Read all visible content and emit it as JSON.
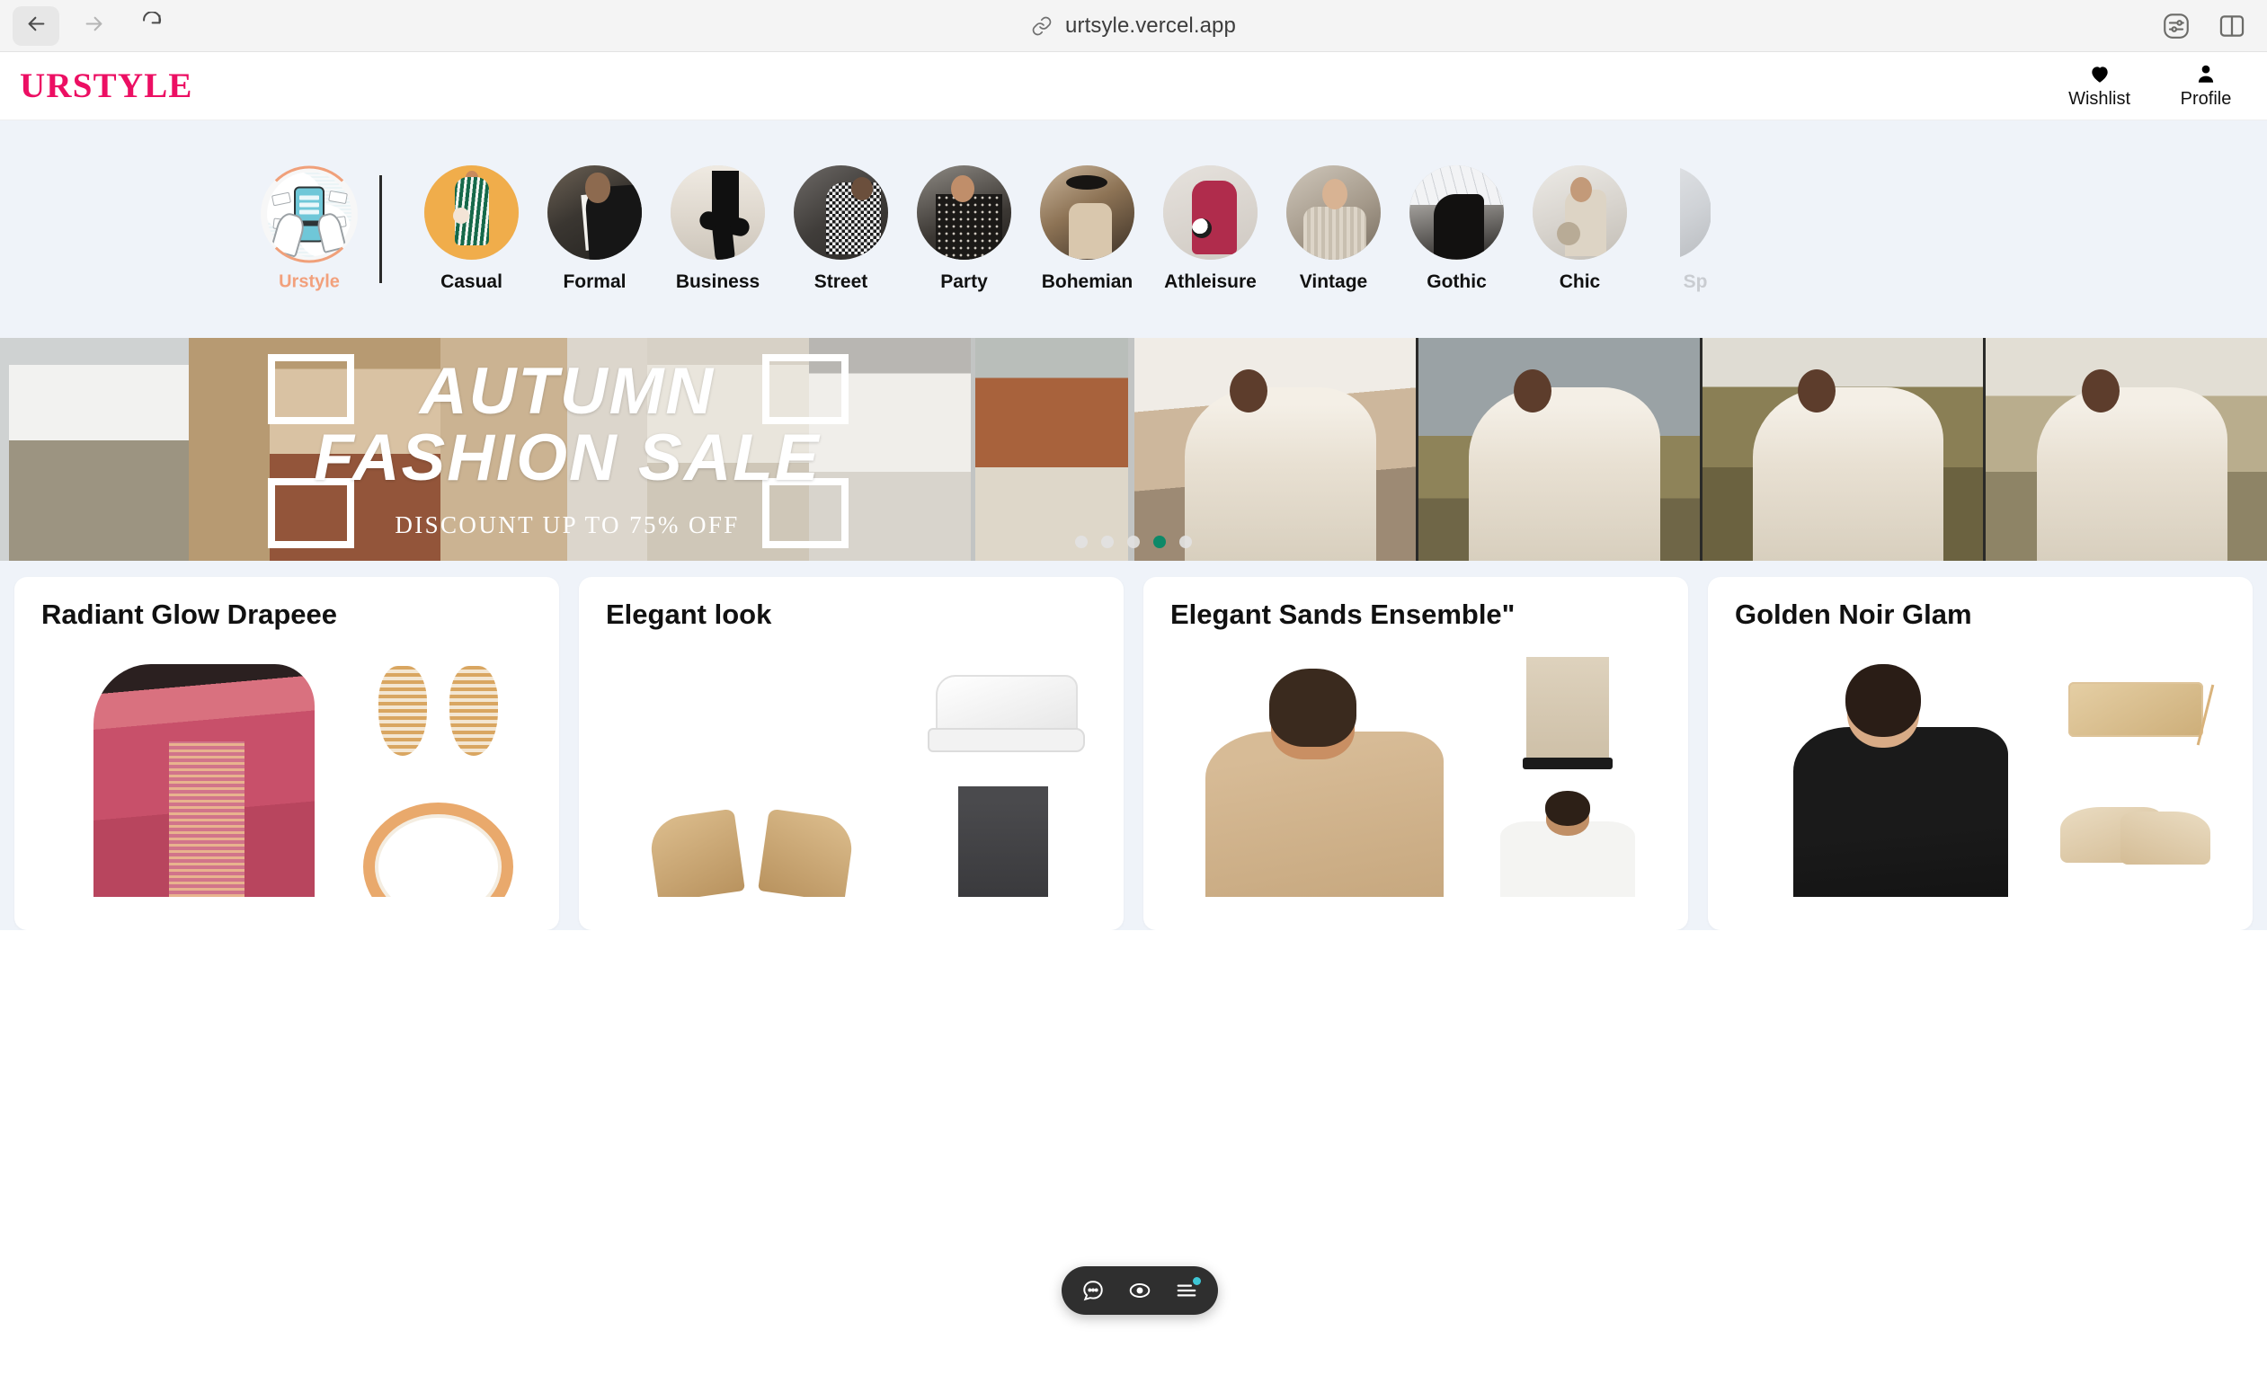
{
  "browser": {
    "url": "urtsyle.vercel.app",
    "nav": {
      "back_label": "Back",
      "forward_label": "Forward",
      "reload_label": "Reload"
    },
    "right_icons": [
      {
        "name": "settings-sliders-icon",
        "label": "Settings"
      },
      {
        "name": "split-panel-icon",
        "label": "Split view"
      }
    ]
  },
  "header": {
    "brand": "URSTYLE",
    "actions": [
      {
        "label": "Wishlist",
        "icon": "heart-icon"
      },
      {
        "label": "Profile",
        "icon": "person-icon"
      }
    ]
  },
  "categories": {
    "brand_item": {
      "label": "Urstyle",
      "color": "#f2a07c"
    },
    "items": [
      {
        "label": "Casual"
      },
      {
        "label": "Formal"
      },
      {
        "label": "Business"
      },
      {
        "label": "Street"
      },
      {
        "label": "Party"
      },
      {
        "label": "Bohemian"
      },
      {
        "label": "Athleisure"
      },
      {
        "label": "Vintage"
      },
      {
        "label": "Gothic"
      },
      {
        "label": "Chic"
      },
      {
        "label": "Sp"
      }
    ]
  },
  "hero": {
    "title_line1": "AUTUMN",
    "title_line2": "FASHION SALE",
    "subtitle": "DISCOUNT UP TO 75% OFF",
    "dots": {
      "count": 5,
      "active_index": 3,
      "active_color": "#0d8968",
      "inactive_color": "#e2e2e2"
    }
  },
  "products": {
    "cards": [
      {
        "title": "Radiant Glow Drapeee"
      },
      {
        "title": "Elegant look"
      },
      {
        "title": "Elegant Sands Ensemble\""
      },
      {
        "title": "Golden Noir Glam"
      }
    ]
  },
  "floating_toolbar": {
    "items": [
      {
        "name": "chat-icon",
        "label": "Chat"
      },
      {
        "name": "eye-icon",
        "label": "Preview"
      },
      {
        "name": "menu-icon",
        "label": "Menu",
        "badge": true
      }
    ],
    "badge_color": "#3ec7d6",
    "background": "#2f2f2f"
  },
  "theme": {
    "brand_pink": "#ec0f63",
    "strip_bg": "#eff3f9",
    "accent_teal": "#0d8968",
    "accent_orange": "#f2a07c"
  }
}
